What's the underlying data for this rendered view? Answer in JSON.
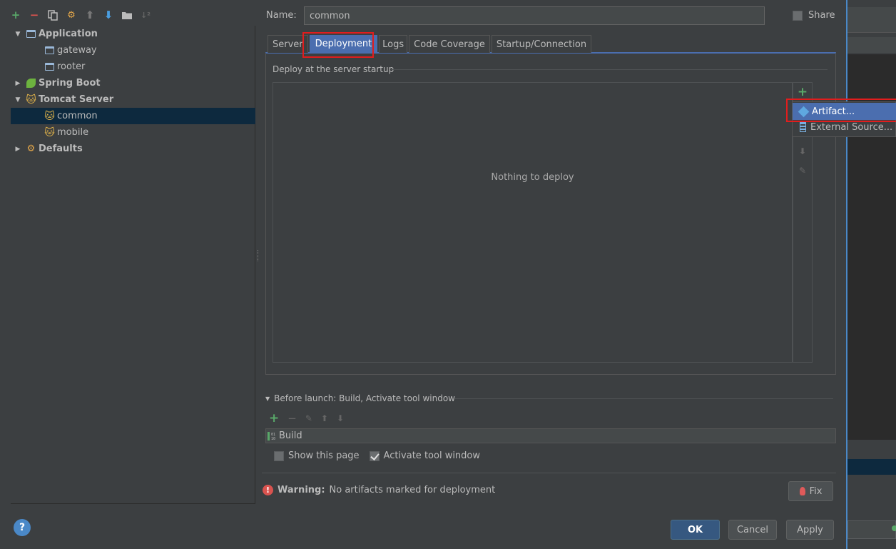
{
  "left_toolbar": {
    "icons": [
      "add-icon",
      "remove-icon",
      "copy-icon",
      "wrench-icon",
      "move-up-icon",
      "move-down-icon",
      "folder-icon",
      "sort-icon"
    ]
  },
  "tree": {
    "items": [
      {
        "label": "Application",
        "level": 0,
        "expanded": true,
        "bold": true,
        "icon": "application-icon"
      },
      {
        "label": "gateway",
        "level": 1,
        "icon": "application-icon"
      },
      {
        "label": "rooter",
        "level": 1,
        "icon": "application-icon"
      },
      {
        "label": "Spring Boot",
        "level": 0,
        "expanded": false,
        "bold": true,
        "icon": "spring-boot-icon"
      },
      {
        "label": "Tomcat Server",
        "level": 0,
        "expanded": true,
        "bold": true,
        "icon": "tomcat-icon"
      },
      {
        "label": "common",
        "level": 1,
        "selected": true,
        "icon": "tomcat-icon"
      },
      {
        "label": "mobile",
        "level": 1,
        "icon": "tomcat-icon"
      },
      {
        "label": "Defaults",
        "level": 0,
        "expanded": false,
        "bold": true,
        "icon": "wrench-icon"
      }
    ]
  },
  "config": {
    "name_label": "Name:",
    "name_value": "common",
    "share_label": "Share",
    "share_checked": false
  },
  "tabs": [
    {
      "label": "Server",
      "active": false
    },
    {
      "label": "Deployment",
      "active": true
    },
    {
      "label": "Logs",
      "active": false
    },
    {
      "label": "Code Coverage",
      "active": false
    },
    {
      "label": "Startup/Connection",
      "active": false
    }
  ],
  "deployment": {
    "section_title": "Deploy at the server startup",
    "empty_text": "Nothing to deploy"
  },
  "add_popup": {
    "items": [
      {
        "label": "Artifact...",
        "icon": "artifact-icon",
        "selected": true
      },
      {
        "label": "External Source...",
        "icon": "external-source-icon",
        "selected": false
      }
    ]
  },
  "before_launch": {
    "title": "Before launch: Build, Activate tool window",
    "tasks": [
      "Build"
    ],
    "show_this_page_label": "Show this page",
    "show_this_page_checked": false,
    "activate_tool_window_label": "Activate tool window",
    "activate_tool_window_checked": true
  },
  "warning": {
    "title": "Warning:",
    "message": "No artifacts marked for deployment",
    "fix_label": "Fix"
  },
  "footer": {
    "ok_label": "OK",
    "cancel_label": "Cancel",
    "apply_label": "Apply"
  },
  "colors": {
    "background": "#3c3f41",
    "accent": "#4b6eaf",
    "selection": "#0d293e",
    "highlight_box": "#e11d1d",
    "add_green": "#59a869",
    "warning_red": "#d9534f"
  }
}
